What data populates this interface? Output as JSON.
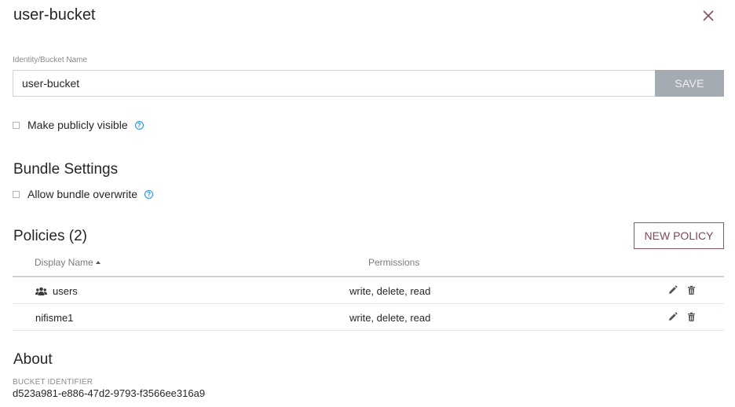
{
  "dialog": {
    "title": "user-bucket",
    "close_icon": "close-icon"
  },
  "identity": {
    "label": "Identity/Bucket Name",
    "value": "user-bucket",
    "save_label": "SAVE"
  },
  "public": {
    "label": "Make publicly visible",
    "checked": false
  },
  "bundle_settings": {
    "heading": "Bundle Settings",
    "allow_overwrite_label": "Allow bundle overwrite",
    "checked": false
  },
  "policies": {
    "heading": "Policies (2)",
    "new_policy_label": "NEW POLICY",
    "columns": {
      "display_name": "Display Name",
      "permissions": "Permissions"
    },
    "rows": [
      {
        "name": "users",
        "icon": "users-group-icon",
        "permissions": "write, delete, read"
      },
      {
        "name": "nifisme1",
        "icon": "",
        "permissions": "write, delete, read"
      }
    ]
  },
  "about": {
    "heading": "About",
    "identifier_label": "BUCKET IDENTIFIER",
    "identifier_value": "d523a981-e886-47d2-9793-f3566ee316a9"
  },
  "colors": {
    "accent": "#7a4a5a",
    "save_disabled_bg": "#a4abb2",
    "help_blue": "#1e90d4"
  }
}
